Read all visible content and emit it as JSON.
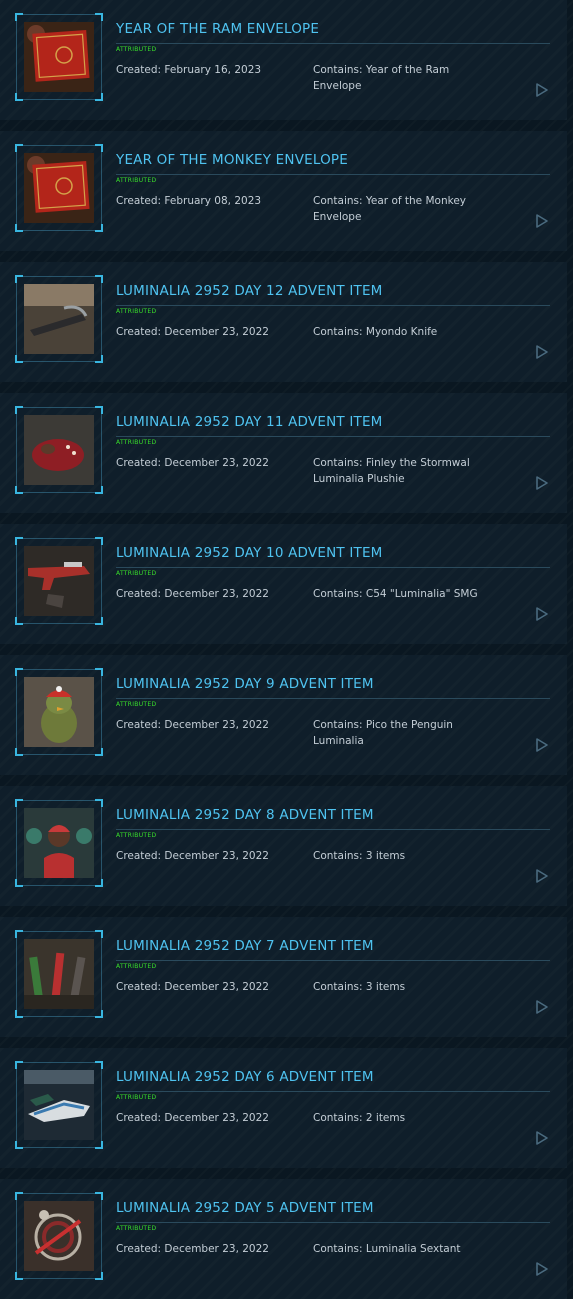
{
  "labels": {
    "created_prefix": "Created: ",
    "contains_prefix": "Contains: "
  },
  "items": [
    {
      "title": "YEAR OF THE RAM ENVELOPE",
      "badge": "ATTRIBUTED",
      "created": "Created: February 16, 2023",
      "contains": "Contains: Year of the Ram Envelope",
      "thumb": "red-envelope"
    },
    {
      "title": "YEAR OF THE MONKEY ENVELOPE",
      "badge": "ATTRIBUTED",
      "created": "Created: February 08, 2023",
      "contains": "Contains: Year of the Monkey Envelope",
      "thumb": "red-envelope"
    },
    {
      "title": "LUMINALIA 2952 DAY 12 ADVENT ITEM",
      "badge": "ATTRIBUTED",
      "created": "Created: December 23, 2022",
      "contains": "Contains: Myondo Knife",
      "thumb": "knife"
    },
    {
      "title": "LUMINALIA 2952 DAY 11 ADVENT ITEM",
      "badge": "ATTRIBUTED",
      "created": "Created: December 23, 2022",
      "contains": "Contains: Finley the Stormwal Luminalia Plushie",
      "thumb": "plushie"
    },
    {
      "title": "LUMINALIA 2952 DAY 10 ADVENT ITEM",
      "badge": "ATTRIBUTED",
      "created": "Created: December 23, 2022",
      "contains": "Contains: C54 \"Luminalia\" SMG",
      "thumb": "smg"
    },
    {
      "title": "LUMINALIA 2952 DAY 9 ADVENT ITEM",
      "badge": "ATTRIBUTED",
      "created": "Created: December 23, 2022",
      "contains": "Contains: Pico the Penguin Luminalia",
      "thumb": "penguin"
    },
    {
      "title": "LUMINALIA 2952 DAY 8 ADVENT ITEM",
      "badge": "ATTRIBUTED",
      "created": "Created: December 23, 2022",
      "contains": "Contains: 3 items",
      "thumb": "people"
    },
    {
      "title": "LUMINALIA 2952 DAY 7 ADVENT ITEM",
      "badge": "ATTRIBUTED",
      "created": "Created: December 23, 2022",
      "contains": "Contains: 3 items",
      "thumb": "weapons"
    },
    {
      "title": "LUMINALIA 2952 DAY 6 ADVENT ITEM",
      "badge": "ATTRIBUTED",
      "created": "Created: December 23, 2022",
      "contains": "Contains: 2 items",
      "thumb": "ship"
    },
    {
      "title": "LUMINALIA 2952 DAY 5 ADVENT ITEM",
      "badge": "ATTRIBUTED",
      "created": "Created: December 23, 2022",
      "contains": "Contains: Luminalia Sextant",
      "thumb": "sextant"
    }
  ],
  "colors": {
    "accent": "#4fc3f0",
    "badge": "#39e02a",
    "text": "#c4ced6"
  },
  "icons": {
    "play": "play-triangle-icon"
  }
}
